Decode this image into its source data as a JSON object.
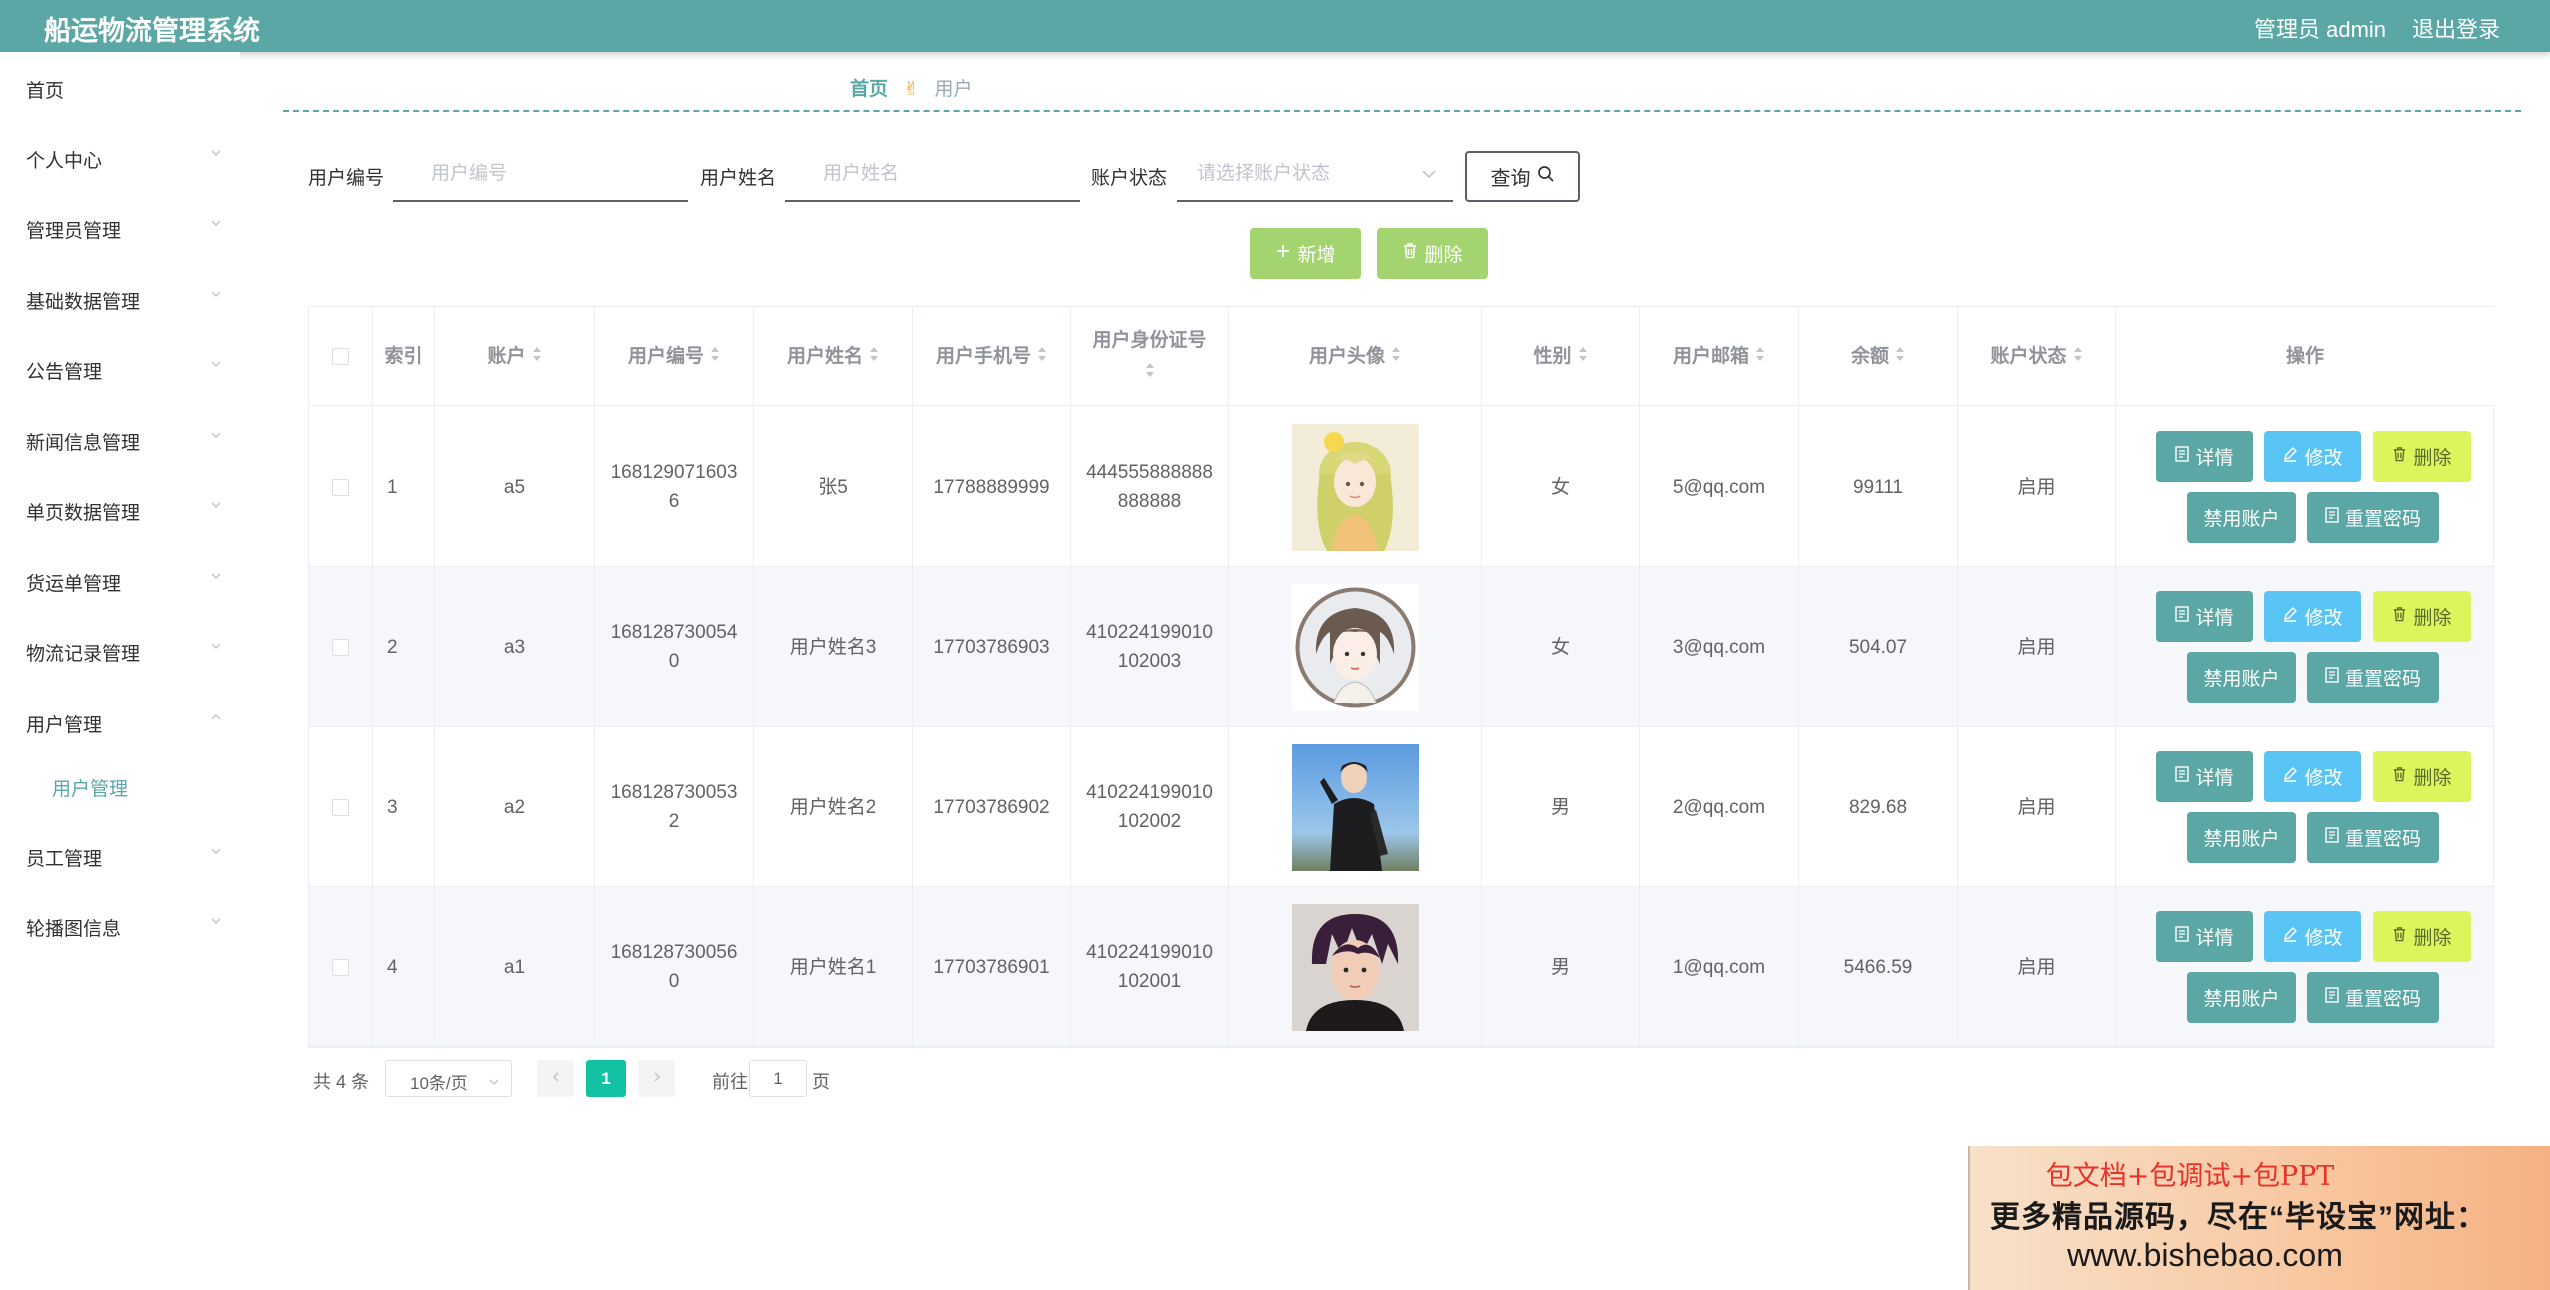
{
  "header": {
    "title": "船运物流管理系统",
    "admin_label": "管理员 admin",
    "logout_label": "退出登录",
    "bar_color": "#5aa7a6"
  },
  "sidebar": {
    "items": [
      {
        "label": "首页",
        "has_arrow": false
      },
      {
        "label": "个人中心",
        "has_arrow": true
      },
      {
        "label": "管理员管理",
        "has_arrow": true
      },
      {
        "label": "基础数据管理",
        "has_arrow": true
      },
      {
        "label": "公告管理",
        "has_arrow": true
      },
      {
        "label": "新闻信息管理",
        "has_arrow": true
      },
      {
        "label": "单页数据管理",
        "has_arrow": true
      },
      {
        "label": "货运单管理",
        "has_arrow": true
      },
      {
        "label": "物流记录管理",
        "has_arrow": true
      },
      {
        "label": "用户管理",
        "has_arrow": true,
        "expanded": true
      },
      {
        "label": "员工管理",
        "has_arrow": true
      },
      {
        "label": "轮播图信息",
        "has_arrow": true
      }
    ],
    "subitem": {
      "label": "用户管理"
    }
  },
  "breadcrumb": {
    "home": "首页",
    "separator_icon": "hand-icon",
    "current": "用户"
  },
  "search": {
    "user_no_label": "用户编号",
    "user_no_placeholder": "用户编号",
    "user_name_label": "用户姓名",
    "user_name_placeholder": "用户姓名",
    "status_label": "账户状态",
    "status_placeholder": "请选择账户状态",
    "query_label": "查询"
  },
  "actions": {
    "add_label": "新增",
    "delete_label": "删除",
    "color": "#a3d46f"
  },
  "table": {
    "columns": [
      "索引",
      "账户",
      "用户编号",
      "用户姓名",
      "用户手机号",
      "用户身份证号",
      "用户头像",
      "性别",
      "用户邮箱",
      "余额",
      "账户状态",
      "操作"
    ],
    "ops": {
      "detail": "详情",
      "edit": "修改",
      "delete": "删除",
      "disable": "禁用账户",
      "reset": "重置密码"
    },
    "rows": [
      {
        "index": "1",
        "account": "a5",
        "user_no": "1681290716036",
        "name": "张5",
        "phone": "17788889999",
        "id_card": "444555888888888888",
        "avatar": "avatar-girl-illustration",
        "gender": "女",
        "email": "5@qq.com",
        "balance": "99111",
        "status": "启用"
      },
      {
        "index": "2",
        "account": "a3",
        "user_no": "1681287300540",
        "name": "用户姓名3",
        "phone": "17703786903",
        "id_card": "410224199010102003",
        "avatar": "avatar-round-girl",
        "gender": "女",
        "email": "3@qq.com",
        "balance": "504.07",
        "status": "启用"
      },
      {
        "index": "3",
        "account": "a2",
        "user_no": "1681287300532",
        "name": "用户姓名2",
        "phone": "17703786902",
        "id_card": "410224199010102002",
        "avatar": "avatar-boy-outdoor",
        "gender": "男",
        "email": "2@qq.com",
        "balance": "829.68",
        "status": "启用"
      },
      {
        "index": "4",
        "account": "a1",
        "user_no": "1681287300560",
        "name": "用户姓名1",
        "phone": "17703786901",
        "id_card": "410224199010102001",
        "avatar": "avatar-boy-dark",
        "gender": "男",
        "email": "1@qq.com",
        "balance": "5466.59",
        "status": "启用"
      }
    ]
  },
  "pagination": {
    "total": "共 4 条",
    "page_size": "10条/页",
    "current": "1",
    "goto_label": "前往",
    "goto_value": "1",
    "page_label": "页"
  },
  "banner": {
    "line1": "包文档+包调试+包PPT",
    "line2": "更多精品源码，尽在“毕设宝”网址：",
    "line3": "www.bishebao.com"
  }
}
